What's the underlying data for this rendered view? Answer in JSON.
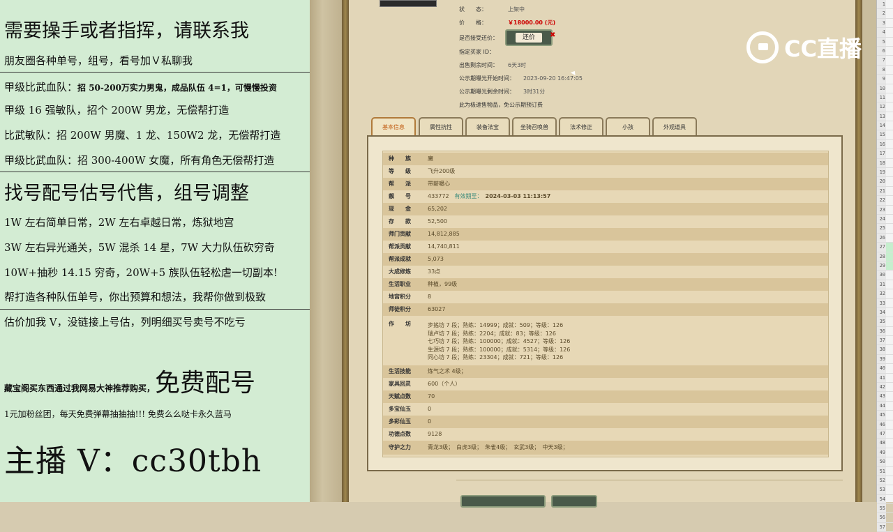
{
  "promo": {
    "l1": "需要操手或者指挥，请联系我",
    "l2": "朋友圈各种单号，组号，看号加Ｖ私聊我",
    "l3": "甲级比武血队：",
    "l3b": "招 50-200万实力男鬼，成品队伍 4=1，可慢慢投资",
    "l4": "甲级 16 强敏队，招个 200W 男龙，无偿帮打造",
    "l5": "比武敏队：招 200W 男魔、1 龙、150W2 龙，无偿帮打造",
    "l6": "甲级比武血队：招 300-400W 女魔，所有角色无偿帮打造",
    "l7": "找号配号估号代售，组号调整",
    "l8": "1W 左右简单日常，2W 左右卓越日常，炼狱地宫",
    "l9": "3W 左右异光通关，5W 混杀 14 星，7W 大力队伍砍穷奇",
    "l10": "10W+抽秒 14.15 穷奇，20W+5 族队伍轻松虐一切副本!",
    "l11": "帮打造各种队伍单号，你出预算和想法，我帮你做到极致",
    "l12": "估价加我 V，没链接上号估，列明细买号卖号不吃亏",
    "l13a": "藏宝阁买东西通过我网易大神推荐购买，",
    "l13b": "免费配号",
    "l14": "1元加粉丝团，每天免费弹幕抽抽抽!!! 免费么么哒卡永久蓝马",
    "l15": "主播 V：cc30tbh"
  },
  "listing": {
    "status_k": "状　　态：",
    "status_v": "上架中",
    "price_k": "价　　格：",
    "price_v": "￥18000.00 (元)",
    "offer_k": "是否接受还价：",
    "offer_btn": "还价",
    "buyer_k": "指定买家 ID：",
    "remain_k": "出售剩余时间：",
    "remain_v": "6天3时",
    "pub_start_k": "公示期曝光开始时间：",
    "pub_start_v": "2023-09-20 16:47:05",
    "pub_remain_k": "公示期曝光剩余时间：",
    "pub_remain_v": "3时31分",
    "note": "此为极速售物品，免公示期预订费"
  },
  "tabs": [
    "基本信息",
    "属性抗性",
    "装备法宝",
    "坐骑召唤兽",
    "法术修正",
    "小孩",
    "外观道具"
  ],
  "rows": [
    {
      "label": "种　　族",
      "value": "魔"
    },
    {
      "label": "等　　级",
      "value": "飞升200级"
    },
    {
      "label": "帮　　派",
      "value": "带薪暖心"
    },
    {
      "label": "靓　　号",
      "value": "433772",
      "extra": "有效期至：",
      "date": "2024-03-03 11:13:57"
    },
    {
      "label": "现　　金",
      "value": "65,202"
    },
    {
      "label": "存　　款",
      "value": "52,500"
    },
    {
      "label": "师门贡献",
      "value": "14,812,885"
    },
    {
      "label": "帮派贡献",
      "value": "14,740,811"
    },
    {
      "label": "帮派成就",
      "value": "5,073"
    },
    {
      "label": "大成修炼",
      "value": "33点"
    },
    {
      "label": "生活职业",
      "value": "种植，99级"
    },
    {
      "label": "地宫积分",
      "value": "8"
    },
    {
      "label": "师徒积分",
      "value": "63027"
    },
    {
      "label": "作　　坊",
      "value": ""
    },
    {
      "label": "生活技能",
      "value": "炼气之术 4级；"
    },
    {
      "label": "家具回灵",
      "value": "600（个人）"
    },
    {
      "label": "天赋点数",
      "value": "70"
    },
    {
      "label": "多宝仙玉",
      "value": "0"
    },
    {
      "label": "多彩仙玉",
      "value": "0"
    },
    {
      "label": "功德点数",
      "value": "9128"
    },
    {
      "label": "守护之力",
      "value": "青龙3级；　白虎3级；　朱雀4级；　玄武3级；　中天3级；"
    }
  ],
  "workshop": [
    "步搖坊 7 段；熟练：14999；成就：509；等级：126",
    "瑞卢坊 7 段；熟练：2204；成就：83；等级：126",
    "七巧坊 7 段；熟练：100000；成就：4527；等级：126",
    "生源坊 7 段；熟练：100000；成就：5314；等级：126",
    "同心坊 7 段；熟练：23304；成就：721；等级：126"
  ],
  "logo_text": "CC直播",
  "excel_rows": [
    "1",
    "2",
    "3",
    "4",
    "5",
    "6",
    "7",
    "8",
    "9",
    "10",
    "11",
    "12",
    "13",
    "14",
    "15",
    "16",
    "17",
    "18",
    "19",
    "20",
    "21",
    "22",
    "23",
    "24",
    "25",
    "26",
    "27",
    "28",
    "29",
    "30",
    "31",
    "32",
    "33",
    "34",
    "35",
    "36",
    "37",
    "38",
    "39",
    "40",
    "41",
    "42",
    "43",
    "44",
    "45",
    "46",
    "47",
    "48",
    "49",
    "50",
    "51",
    "52",
    "53",
    "54",
    "55",
    "56",
    "57"
  ]
}
